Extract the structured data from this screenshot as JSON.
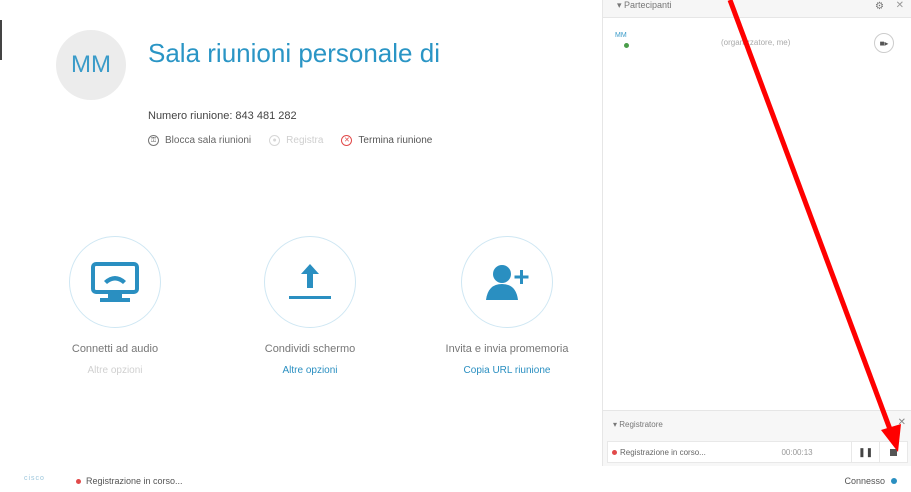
{
  "meeting": {
    "avatar_initials": "MM",
    "title": "Sala riunioni personale di",
    "number_label": "Numero riunione: 843 481 282",
    "actions": {
      "lock_label": "Blocca sala riunioni",
      "record_label": "Registra",
      "end_label": "Termina riunione"
    }
  },
  "tiles": [
    {
      "label": "Connetti ad audio",
      "sub": "Altre opzioni",
      "icon": "audio-monitor-icon"
    },
    {
      "label": "Condividi schermo",
      "sub": "Altre opzioni",
      "icon": "upload-icon"
    },
    {
      "label": "Invita e invia promemoria",
      "sub": "Copia URL riunione",
      "icon": "add-user-icon"
    }
  ],
  "participants": {
    "header": "Partecipanti",
    "row": {
      "initials": "MM",
      "role": "(organizzatore, me)"
    }
  },
  "recorder": {
    "title": "Registratore",
    "status": "Registrazione in corso...",
    "time": "00:00:13"
  },
  "status_bar": {
    "logo": "cisco",
    "recording_status": "Registrazione in corso...",
    "connection": "Connesso"
  },
  "colors": {
    "accent": "#2a95c5",
    "recording": "#e14a4a",
    "annotation_arrow": "#ff0000"
  }
}
